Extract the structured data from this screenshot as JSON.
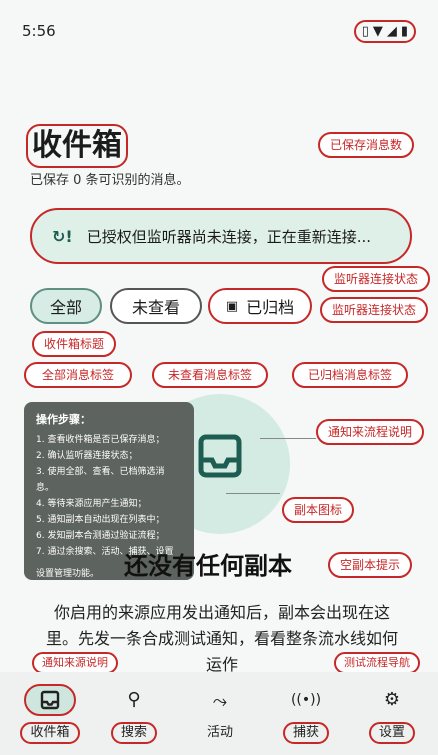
{
  "status": {
    "time": "5:56",
    "icons": [
      "vibrate-icon",
      "wifi-icon",
      "signal-icon",
      "battery-icon"
    ]
  },
  "header": {
    "title": "收件箱",
    "subtitle": "已保存 0 条可识别的消息。",
    "saved_count_badge": "已保存消息数",
    "title_badge": "收件箱标题"
  },
  "listener": {
    "text": "已授权但监听器尚未连接，正在重新连接...",
    "badge": "监听器连接状态"
  },
  "filters": {
    "all": "全部",
    "unviewed": "未查看",
    "archived": "已归档",
    "badge": "监听器连接状态",
    "all_badge": "全部消息标签",
    "unviewed_badge": "未查看消息标签",
    "archived_badge": "已归档消息标签"
  },
  "instructions": {
    "title": "操作步骤：",
    "steps": [
      "1. 查看收件箱是否已保存消息；",
      "2. 确认监听器连接状态；",
      "3. 使用全部、查看、已档筛选消息。",
      "4. 等待来源应用产生通知；",
      "5. 通知副本自动出现在列表中；",
      "6. 发知副本合测通过验证流程；",
      "7. 通过余搜索、活动、捕获、设置"
    ],
    "extra": "设置管理功能。"
  },
  "empty_state": {
    "flow_badge": "通知来流程说明",
    "icon_badge": "副本图标",
    "title": "还没有任何副本",
    "title_badge": "空副本提示",
    "description": "你启用的来源应用发出通知后，副本会出现在这里。先发一条合成测试通知，看看整条流水线如何运作",
    "source_badge": "通知来源说明",
    "test_badge": "测试流程导航"
  },
  "nav": {
    "items": [
      {
        "label": "收件箱",
        "icon": "inbox-icon"
      },
      {
        "label": "搜索",
        "icon": "search-icon"
      },
      {
        "label": "活动",
        "icon": "activity-icon"
      },
      {
        "label": "捕获",
        "icon": "capture-icon"
      },
      {
        "label": "设置",
        "icon": "gear-icon"
      }
    ]
  },
  "colors": {
    "accent": "#c62828",
    "primary": "#1e5d52",
    "chip_active": "#d6ece4"
  }
}
